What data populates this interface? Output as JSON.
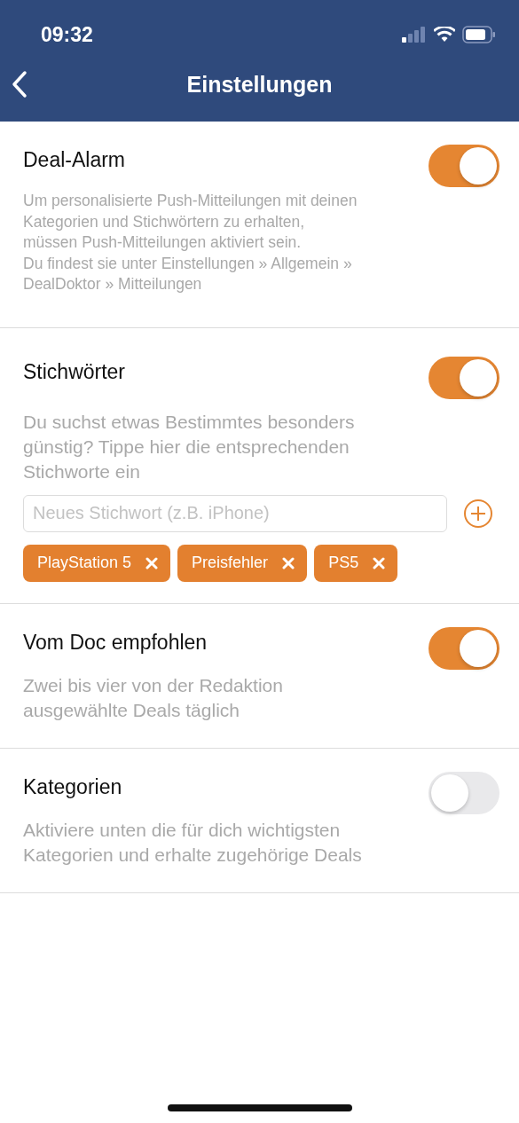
{
  "status_bar": {
    "time": "09:32"
  },
  "nav": {
    "title": "Einstellungen"
  },
  "sections": [
    {
      "kind": "note",
      "title": "Deal-Alarm",
      "on": true,
      "description": "Um personalisierte Push-Mitteilungen mit deinen\nKategorien und Stichwörtern zu erhalten,\nmüssen Push-Mitteilungen aktiviert sein.\nDu findest sie unter Einstellungen » Allgemein »\nDealDoktor » Mitteilungen"
    },
    {
      "kind": "keywords",
      "title": "Stichwörter",
      "on": true,
      "description": "Du suchst etwas Bestimmtes besonders\ngünstig? Tippe hier die entsprechenden\nStichworte ein",
      "input": {
        "placeholder": "Neues Stichwort (z.B. iPhone)"
      },
      "tags": [
        "PlayStation 5",
        "Preisfehler",
        "PS5"
      ]
    },
    {
      "kind": "hint",
      "title": "Vom Doc empfohlen",
      "on": true,
      "description": "Zwei bis vier von der Redaktion\nausgewählte Deals täglich"
    },
    {
      "kind": "hint",
      "title": "Kategorien",
      "on": false,
      "description": "Aktiviere unten die für dich wichtigsten\nKategorien und erhalte zugehörige Deals"
    }
  ]
}
